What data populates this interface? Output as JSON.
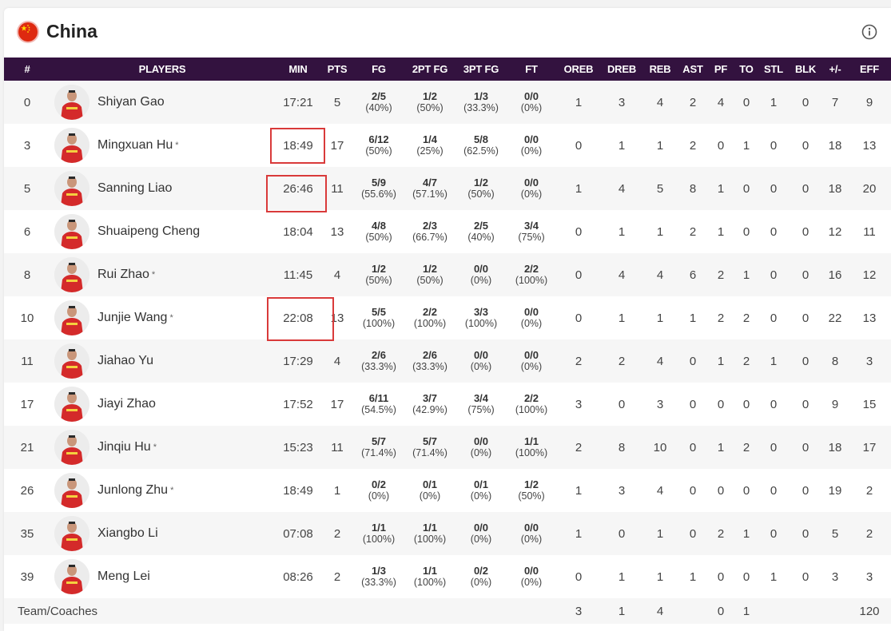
{
  "team": {
    "name": "China",
    "flag_color": "#de2910",
    "info_icon": "info-circle-icon"
  },
  "header_color": "#33123f",
  "highlight_color": "#d93a3a",
  "columns": [
    "#",
    "PLAYERS",
    "MIN",
    "PTS",
    "FG",
    "2PT FG",
    "3PT FG",
    "FT",
    "OREB",
    "DREB",
    "REB",
    "AST",
    "PF",
    "TO",
    "STL",
    "BLK",
    "+/-",
    "EFF"
  ],
  "players": [
    {
      "num": "0",
      "name": "Shiyan Gao",
      "starter": false,
      "min": "17:21",
      "pts": "5",
      "fg": [
        "2/5",
        "(40%)"
      ],
      "fg2": [
        "1/2",
        "(50%)"
      ],
      "fg3": [
        "1/3",
        "(33.3%)"
      ],
      "ft": [
        "0/0",
        "(0%)"
      ],
      "oreb": "1",
      "dreb": "3",
      "reb": "4",
      "ast": "2",
      "pf": "4",
      "to": "0",
      "stl": "1",
      "blk": "0",
      "pm": "7",
      "eff": "9"
    },
    {
      "num": "3",
      "name": "Mingxuan Hu",
      "starter": true,
      "min": "18:49",
      "pts": "17",
      "fg": [
        "6/12",
        "(50%)"
      ],
      "fg2": [
        "1/4",
        "(25%)"
      ],
      "fg3": [
        "5/8",
        "(62.5%)"
      ],
      "ft": [
        "0/0",
        "(0%)"
      ],
      "oreb": "0",
      "dreb": "1",
      "reb": "1",
      "ast": "2",
      "pf": "0",
      "to": "1",
      "stl": "0",
      "blk": "0",
      "pm": "18",
      "eff": "13"
    },
    {
      "num": "5",
      "name": "Sanning Liao",
      "starter": false,
      "min": "26:46",
      "pts": "11",
      "fg": [
        "5/9",
        "(55.6%)"
      ],
      "fg2": [
        "4/7",
        "(57.1%)"
      ],
      "fg3": [
        "1/2",
        "(50%)"
      ],
      "ft": [
        "0/0",
        "(0%)"
      ],
      "oreb": "1",
      "dreb": "4",
      "reb": "5",
      "ast": "8",
      "pf": "1",
      "to": "0",
      "stl": "0",
      "blk": "0",
      "pm": "18",
      "eff": "20"
    },
    {
      "num": "6",
      "name": "Shuaipeng Cheng",
      "starter": false,
      "min": "18:04",
      "pts": "13",
      "fg": [
        "4/8",
        "(50%)"
      ],
      "fg2": [
        "2/3",
        "(66.7%)"
      ],
      "fg3": [
        "2/5",
        "(40%)"
      ],
      "ft": [
        "3/4",
        "(75%)"
      ],
      "oreb": "0",
      "dreb": "1",
      "reb": "1",
      "ast": "2",
      "pf": "1",
      "to": "0",
      "stl": "0",
      "blk": "0",
      "pm": "12",
      "eff": "11"
    },
    {
      "num": "8",
      "name": "Rui Zhao",
      "starter": true,
      "min": "11:45",
      "pts": "4",
      "fg": [
        "1/2",
        "(50%)"
      ],
      "fg2": [
        "1/2",
        "(50%)"
      ],
      "fg3": [
        "0/0",
        "(0%)"
      ],
      "ft": [
        "2/2",
        "(100%)"
      ],
      "oreb": "0",
      "dreb": "4",
      "reb": "4",
      "ast": "6",
      "pf": "2",
      "to": "1",
      "stl": "0",
      "blk": "0",
      "pm": "16",
      "eff": "12"
    },
    {
      "num": "10",
      "name": "Junjie Wang",
      "starter": true,
      "min": "22:08",
      "pts": "13",
      "fg": [
        "5/5",
        "(100%)"
      ],
      "fg2": [
        "2/2",
        "(100%)"
      ],
      "fg3": [
        "3/3",
        "(100%)"
      ],
      "ft": [
        "0/0",
        "(0%)"
      ],
      "oreb": "0",
      "dreb": "1",
      "reb": "1",
      "ast": "1",
      "pf": "2",
      "to": "2",
      "stl": "0",
      "blk": "0",
      "pm": "22",
      "eff": "13"
    },
    {
      "num": "11",
      "name": "Jiahao Yu",
      "starter": false,
      "min": "17:29",
      "pts": "4",
      "fg": [
        "2/6",
        "(33.3%)"
      ],
      "fg2": [
        "2/6",
        "(33.3%)"
      ],
      "fg3": [
        "0/0",
        "(0%)"
      ],
      "ft": [
        "0/0",
        "(0%)"
      ],
      "oreb": "2",
      "dreb": "2",
      "reb": "4",
      "ast": "0",
      "pf": "1",
      "to": "2",
      "stl": "1",
      "blk": "0",
      "pm": "8",
      "eff": "3"
    },
    {
      "num": "17",
      "name": "Jiayi Zhao",
      "starter": false,
      "min": "17:52",
      "pts": "17",
      "fg": [
        "6/11",
        "(54.5%)"
      ],
      "fg2": [
        "3/7",
        "(42.9%)"
      ],
      "fg3": [
        "3/4",
        "(75%)"
      ],
      "ft": [
        "2/2",
        "(100%)"
      ],
      "oreb": "3",
      "dreb": "0",
      "reb": "3",
      "ast": "0",
      "pf": "0",
      "to": "0",
      "stl": "0",
      "blk": "0",
      "pm": "9",
      "eff": "15"
    },
    {
      "num": "21",
      "name": "Jinqiu Hu",
      "starter": true,
      "min": "15:23",
      "pts": "11",
      "fg": [
        "5/7",
        "(71.4%)"
      ],
      "fg2": [
        "5/7",
        "(71.4%)"
      ],
      "fg3": [
        "0/0",
        "(0%)"
      ],
      "ft": [
        "1/1",
        "(100%)"
      ],
      "oreb": "2",
      "dreb": "8",
      "reb": "10",
      "ast": "0",
      "pf": "1",
      "to": "2",
      "stl": "0",
      "blk": "0",
      "pm": "18",
      "eff": "17"
    },
    {
      "num": "26",
      "name": "Junlong Zhu",
      "starter": true,
      "min": "18:49",
      "pts": "1",
      "fg": [
        "0/2",
        "(0%)"
      ],
      "fg2": [
        "0/1",
        "(0%)"
      ],
      "fg3": [
        "0/1",
        "(0%)"
      ],
      "ft": [
        "1/2",
        "(50%)"
      ],
      "oreb": "1",
      "dreb": "3",
      "reb": "4",
      "ast": "0",
      "pf": "0",
      "to": "0",
      "stl": "0",
      "blk": "0",
      "pm": "19",
      "eff": "2"
    },
    {
      "num": "35",
      "name": "Xiangbo Li",
      "starter": false,
      "min": "07:08",
      "pts": "2",
      "fg": [
        "1/1",
        "(100%)"
      ],
      "fg2": [
        "1/1",
        "(100%)"
      ],
      "fg3": [
        "0/0",
        "(0%)"
      ],
      "ft": [
        "0/0",
        "(0%)"
      ],
      "oreb": "1",
      "dreb": "0",
      "reb": "1",
      "ast": "0",
      "pf": "2",
      "to": "1",
      "stl": "0",
      "blk": "0",
      "pm": "5",
      "eff": "2"
    },
    {
      "num": "39",
      "name": "Meng Lei",
      "starter": false,
      "min": "08:26",
      "pts": "2",
      "fg": [
        "1/3",
        "(33.3%)"
      ],
      "fg2": [
        "1/1",
        "(100%)"
      ],
      "fg3": [
        "0/2",
        "(0%)"
      ],
      "ft": [
        "0/0",
        "(0%)"
      ],
      "oreb": "0",
      "dreb": "1",
      "reb": "1",
      "ast": "1",
      "pf": "0",
      "to": "0",
      "stl": "1",
      "blk": "0",
      "pm": "3",
      "eff": "3"
    }
  ],
  "team_row": {
    "label": "Team/Coaches",
    "oreb": "3",
    "dreb": "1",
    "reb": "4",
    "pf": "0",
    "to": "1",
    "eff": "120"
  },
  "starter_mark": "*"
}
